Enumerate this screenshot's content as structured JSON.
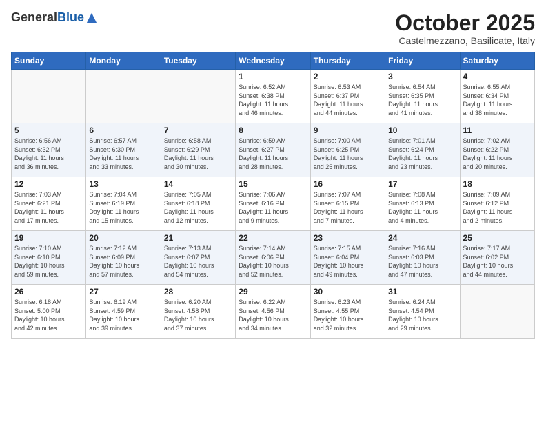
{
  "header": {
    "logo_general": "General",
    "logo_blue": "Blue",
    "month": "October 2025",
    "location": "Castelmezzano, Basilicate, Italy"
  },
  "weekdays": [
    "Sunday",
    "Monday",
    "Tuesday",
    "Wednesday",
    "Thursday",
    "Friday",
    "Saturday"
  ],
  "weeks": [
    [
      {
        "day": "",
        "info": ""
      },
      {
        "day": "",
        "info": ""
      },
      {
        "day": "",
        "info": ""
      },
      {
        "day": "1",
        "info": "Sunrise: 6:52 AM\nSunset: 6:38 PM\nDaylight: 11 hours\nand 46 minutes."
      },
      {
        "day": "2",
        "info": "Sunrise: 6:53 AM\nSunset: 6:37 PM\nDaylight: 11 hours\nand 44 minutes."
      },
      {
        "day": "3",
        "info": "Sunrise: 6:54 AM\nSunset: 6:35 PM\nDaylight: 11 hours\nand 41 minutes."
      },
      {
        "day": "4",
        "info": "Sunrise: 6:55 AM\nSunset: 6:34 PM\nDaylight: 11 hours\nand 38 minutes."
      }
    ],
    [
      {
        "day": "5",
        "info": "Sunrise: 6:56 AM\nSunset: 6:32 PM\nDaylight: 11 hours\nand 36 minutes."
      },
      {
        "day": "6",
        "info": "Sunrise: 6:57 AM\nSunset: 6:30 PM\nDaylight: 11 hours\nand 33 minutes."
      },
      {
        "day": "7",
        "info": "Sunrise: 6:58 AM\nSunset: 6:29 PM\nDaylight: 11 hours\nand 30 minutes."
      },
      {
        "day": "8",
        "info": "Sunrise: 6:59 AM\nSunset: 6:27 PM\nDaylight: 11 hours\nand 28 minutes."
      },
      {
        "day": "9",
        "info": "Sunrise: 7:00 AM\nSunset: 6:25 PM\nDaylight: 11 hours\nand 25 minutes."
      },
      {
        "day": "10",
        "info": "Sunrise: 7:01 AM\nSunset: 6:24 PM\nDaylight: 11 hours\nand 23 minutes."
      },
      {
        "day": "11",
        "info": "Sunrise: 7:02 AM\nSunset: 6:22 PM\nDaylight: 11 hours\nand 20 minutes."
      }
    ],
    [
      {
        "day": "12",
        "info": "Sunrise: 7:03 AM\nSunset: 6:21 PM\nDaylight: 11 hours\nand 17 minutes."
      },
      {
        "day": "13",
        "info": "Sunrise: 7:04 AM\nSunset: 6:19 PM\nDaylight: 11 hours\nand 15 minutes."
      },
      {
        "day": "14",
        "info": "Sunrise: 7:05 AM\nSunset: 6:18 PM\nDaylight: 11 hours\nand 12 minutes."
      },
      {
        "day": "15",
        "info": "Sunrise: 7:06 AM\nSunset: 6:16 PM\nDaylight: 11 hours\nand 9 minutes."
      },
      {
        "day": "16",
        "info": "Sunrise: 7:07 AM\nSunset: 6:15 PM\nDaylight: 11 hours\nand 7 minutes."
      },
      {
        "day": "17",
        "info": "Sunrise: 7:08 AM\nSunset: 6:13 PM\nDaylight: 11 hours\nand 4 minutes."
      },
      {
        "day": "18",
        "info": "Sunrise: 7:09 AM\nSunset: 6:12 PM\nDaylight: 11 hours\nand 2 minutes."
      }
    ],
    [
      {
        "day": "19",
        "info": "Sunrise: 7:10 AM\nSunset: 6:10 PM\nDaylight: 10 hours\nand 59 minutes."
      },
      {
        "day": "20",
        "info": "Sunrise: 7:12 AM\nSunset: 6:09 PM\nDaylight: 10 hours\nand 57 minutes."
      },
      {
        "day": "21",
        "info": "Sunrise: 7:13 AM\nSunset: 6:07 PM\nDaylight: 10 hours\nand 54 minutes."
      },
      {
        "day": "22",
        "info": "Sunrise: 7:14 AM\nSunset: 6:06 PM\nDaylight: 10 hours\nand 52 minutes."
      },
      {
        "day": "23",
        "info": "Sunrise: 7:15 AM\nSunset: 6:04 PM\nDaylight: 10 hours\nand 49 minutes."
      },
      {
        "day": "24",
        "info": "Sunrise: 7:16 AM\nSunset: 6:03 PM\nDaylight: 10 hours\nand 47 minutes."
      },
      {
        "day": "25",
        "info": "Sunrise: 7:17 AM\nSunset: 6:02 PM\nDaylight: 10 hours\nand 44 minutes."
      }
    ],
    [
      {
        "day": "26",
        "info": "Sunrise: 6:18 AM\nSunset: 5:00 PM\nDaylight: 10 hours\nand 42 minutes."
      },
      {
        "day": "27",
        "info": "Sunrise: 6:19 AM\nSunset: 4:59 PM\nDaylight: 10 hours\nand 39 minutes."
      },
      {
        "day": "28",
        "info": "Sunrise: 6:20 AM\nSunset: 4:58 PM\nDaylight: 10 hours\nand 37 minutes."
      },
      {
        "day": "29",
        "info": "Sunrise: 6:22 AM\nSunset: 4:56 PM\nDaylight: 10 hours\nand 34 minutes."
      },
      {
        "day": "30",
        "info": "Sunrise: 6:23 AM\nSunset: 4:55 PM\nDaylight: 10 hours\nand 32 minutes."
      },
      {
        "day": "31",
        "info": "Sunrise: 6:24 AM\nSunset: 4:54 PM\nDaylight: 10 hours\nand 29 minutes."
      },
      {
        "day": "",
        "info": ""
      }
    ]
  ]
}
